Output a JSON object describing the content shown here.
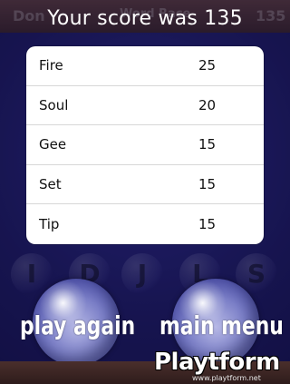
{
  "header": {
    "score_text": "Your score was 135",
    "bg_left": "Don",
    "bg_middle": "Word Race",
    "bg_right": "135"
  },
  "results": {
    "rows": [
      {
        "word": "Fire",
        "points": "25"
      },
      {
        "word": "Soul",
        "points": "20"
      },
      {
        "word": "Gee",
        "points": "15"
      },
      {
        "word": "Set",
        "points": "15"
      },
      {
        "word": "Tip",
        "points": "15"
      }
    ]
  },
  "board": {
    "letters": [
      "I",
      "D",
      "J",
      "L",
      "S"
    ]
  },
  "buttons": {
    "play_again": "play again",
    "main_menu": "main menu"
  },
  "watermark": {
    "name": "Playtform",
    "url": "www.playtform.net"
  },
  "colors": {
    "background": "#1f1b5e",
    "panel": "#ffffff",
    "text": "#111111"
  }
}
